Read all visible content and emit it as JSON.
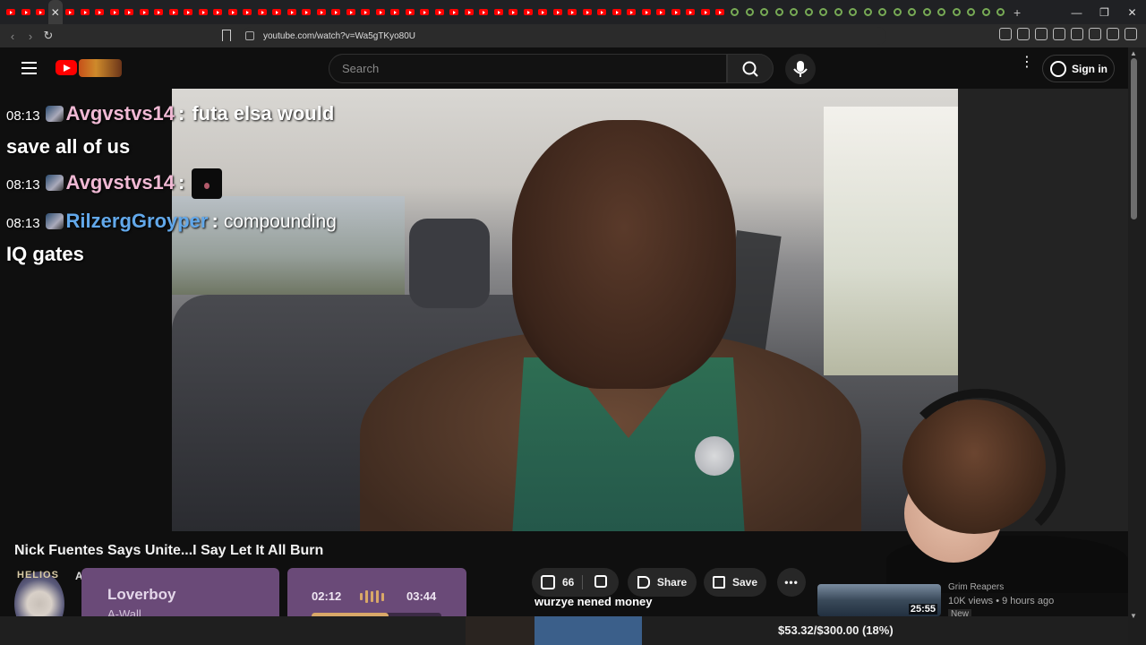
{
  "browser": {
    "url": "youtube.com/watch?v=Wa5gTKyo80U",
    "tab_count": 68
  },
  "youtube": {
    "search_placeholder": "Search",
    "signin_label": "Sign in"
  },
  "chat": [
    {
      "time": "08:13",
      "user": "Avgvstvs14",
      "sep": ":",
      "text": "futa elsa would save all of us"
    },
    {
      "time": "08:13",
      "user": "Avgvstvs14",
      "sep": ":",
      "text": ""
    },
    {
      "time": "08:13",
      "user": "RilzergGroyper",
      "sep": ":",
      "text": "compounding",
      "text2": "IQ gates"
    }
  ],
  "video": {
    "title": "Nick Fuentes Says Unite...I Say Let It All Burn",
    "channel_initial": "A",
    "likes": "66",
    "share_label": "Share",
    "save_label": "Save",
    "comment": "wurzye nened money"
  },
  "now_playing": {
    "album_label": "HELIOS",
    "song": "Loverboy",
    "artist": "A-Wall",
    "current": "02:12",
    "total": "03:44",
    "progress": 0.59
  },
  "recommended": {
    "duration": "25:55",
    "title": "Grim Reapers",
    "meta": "10K views • 9 hours ago",
    "badge": "New"
  },
  "donation_goal": "$53.32/$300.00 (18%)",
  "colors": {
    "accent": "#ff0000",
    "chat_user_1": "#f0b9d4",
    "chat_user_2": "#62a8ea",
    "player_card": "#6a4a78",
    "progress": "#d9a868"
  }
}
